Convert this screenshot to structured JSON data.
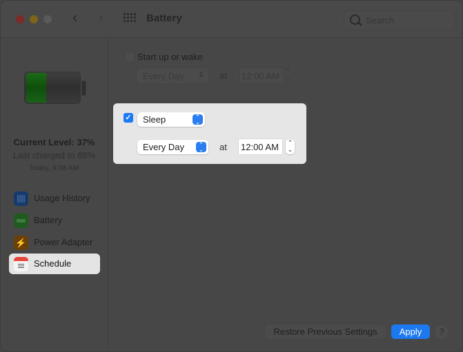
{
  "window": {
    "title": "Battery",
    "search_placeholder": "Search",
    "nav": {
      "back": "‹",
      "forward": "›"
    }
  },
  "sidebar": {
    "battery_status": {
      "level_fraction": 0.37,
      "current_level": "Current Level: 37%",
      "last_charged": "Last charged to 88%",
      "charged_time": "Today, 9:08 AM"
    },
    "items": [
      {
        "label": "Usage History",
        "icon": "usage-history-icon",
        "active": false
      },
      {
        "label": "Battery",
        "icon": "battery-icon",
        "active": false
      },
      {
        "label": "Power Adapter",
        "icon": "power-adapter-icon",
        "active": false
      },
      {
        "label": "Schedule",
        "icon": "schedule-icon",
        "active": true
      }
    ]
  },
  "schedule": {
    "startup": {
      "checked": false,
      "label": "Start up or wake",
      "frequency": "Every Day",
      "at_label": "at",
      "time": "12:00 AM"
    },
    "sleep": {
      "checked": true,
      "check_glyph": "✓",
      "action": "Sleep",
      "frequency": "Every Day",
      "at_label": "at",
      "time": "12:00 AM",
      "popup_arrows": "⌃⌄",
      "stepper_up": "⌃",
      "stepper_down": "⌄"
    }
  },
  "footer": {
    "restore_label": "Restore Previous Settings",
    "apply_label": "Apply",
    "help_label": "?"
  },
  "colors": {
    "accent": "#1c79f0",
    "battery_green": "#1a6b16",
    "schedule_red": "#e8463a"
  }
}
